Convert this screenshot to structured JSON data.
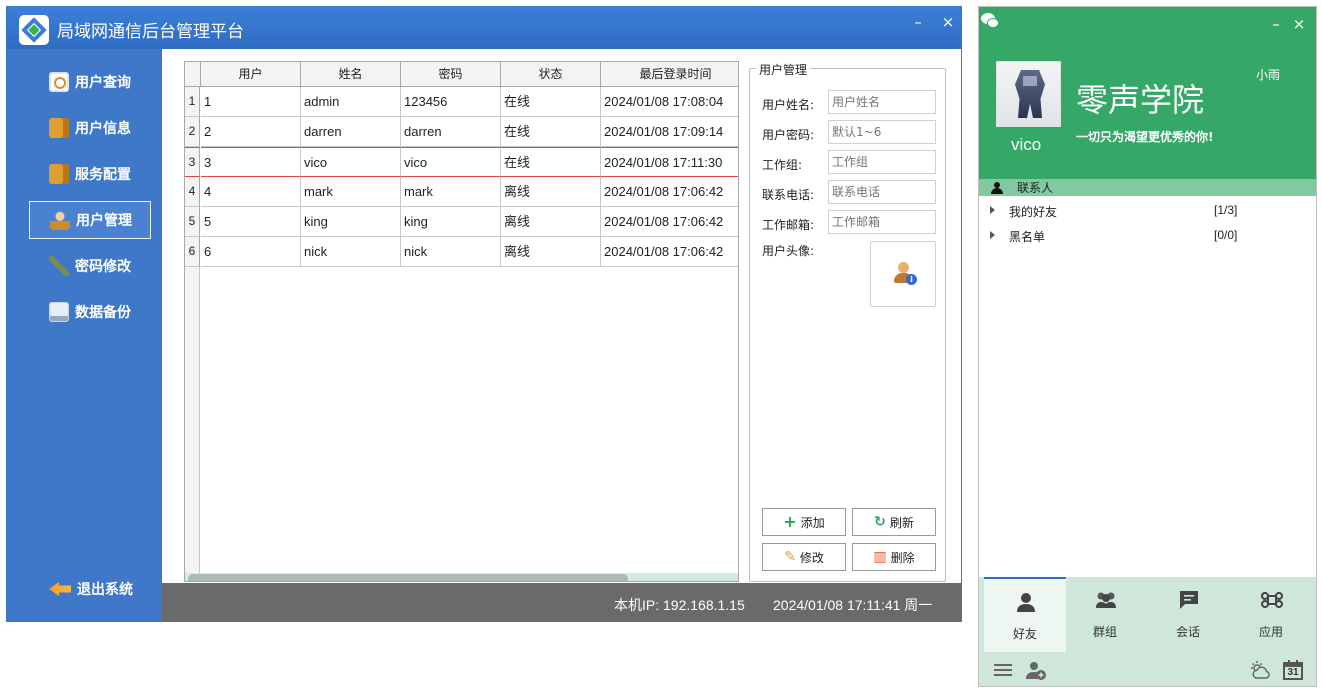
{
  "admin": {
    "title": "局域网通信后台管理平台",
    "min_label": "–",
    "close_label": "×",
    "nav": [
      {
        "label": "用户查询",
        "icon": "search-icon"
      },
      {
        "label": "用户信息",
        "icon": "box-icon"
      },
      {
        "label": "服务配置",
        "icon": "box-icon"
      },
      {
        "label": "用户管理",
        "icon": "user-icon"
      },
      {
        "label": "密码修改",
        "icon": "key-icon"
      },
      {
        "label": "数据备份",
        "icon": "disk-icon"
      }
    ],
    "exit_label": "退出系统",
    "table": {
      "headers": [
        "用户",
        "姓名",
        "密码",
        "状态",
        "最后登录时间"
      ],
      "rows": [
        {
          "num": "1",
          "user": "1",
          "name": "admin",
          "password": "123456",
          "status": "在线",
          "time": "2024/01/08 17:08:04"
        },
        {
          "num": "2",
          "user": "2",
          "name": "darren",
          "password": "darren",
          "status": "在线",
          "time": "2024/01/08 17:09:14"
        },
        {
          "num": "3",
          "user": "3",
          "name": "vico",
          "password": "vico",
          "status": "在线",
          "time": "2024/01/08 17:11:30"
        },
        {
          "num": "4",
          "user": "4",
          "name": "mark",
          "password": "mark",
          "status": "离线",
          "time": "2024/01/08 17:06:42"
        },
        {
          "num": "5",
          "user": "5",
          "name": "king",
          "password": "king",
          "status": "离线",
          "time": "2024/01/08 17:06:42"
        },
        {
          "num": "6",
          "user": "6",
          "name": "nick",
          "password": "nick",
          "status": "离线",
          "time": "2024/01/08 17:06:42"
        }
      ]
    },
    "form": {
      "legend": "用户管理",
      "fields": [
        {
          "label": "用户姓名:",
          "placeholder": "用户姓名"
        },
        {
          "label": "用户密码:",
          "placeholder": "默认1~6"
        },
        {
          "label": "工作组:",
          "placeholder": "工作组"
        },
        {
          "label": "联系电话:",
          "placeholder": "联系电话"
        },
        {
          "label": "工作邮箱:",
          "placeholder": "工作邮箱"
        }
      ],
      "avatar_label": "用户头像:",
      "buttons": {
        "add": "添加",
        "refresh": "刷新",
        "edit": "修改",
        "delete": "删除"
      }
    },
    "status": {
      "ip": "本机IP:  192.168.1.15",
      "time": "2024/01/08 17:11:41 周一"
    }
  },
  "chat": {
    "min_label": "–",
    "close_label": "×",
    "nickname": "vico",
    "brand": "零声学院",
    "slogan": "一切只为渴望更优秀的你!",
    "username": "小雨",
    "contacts_label": "联系人",
    "groups": [
      {
        "label": "我的好友",
        "count": "[1/3]"
      },
      {
        "label": "黑名单",
        "count": "[0/0]"
      }
    ],
    "tabs": [
      {
        "label": "好友",
        "icon": "friend-icon"
      },
      {
        "label": "群组",
        "icon": "group-icon"
      },
      {
        "label": "会话",
        "icon": "chat-icon"
      },
      {
        "label": "应用",
        "icon": "app-icon"
      }
    ],
    "calendar_day": "31",
    "colors": {
      "primary": "#35a868",
      "tabbar": "#cfe7db",
      "accent": "#2f6cc4"
    }
  }
}
